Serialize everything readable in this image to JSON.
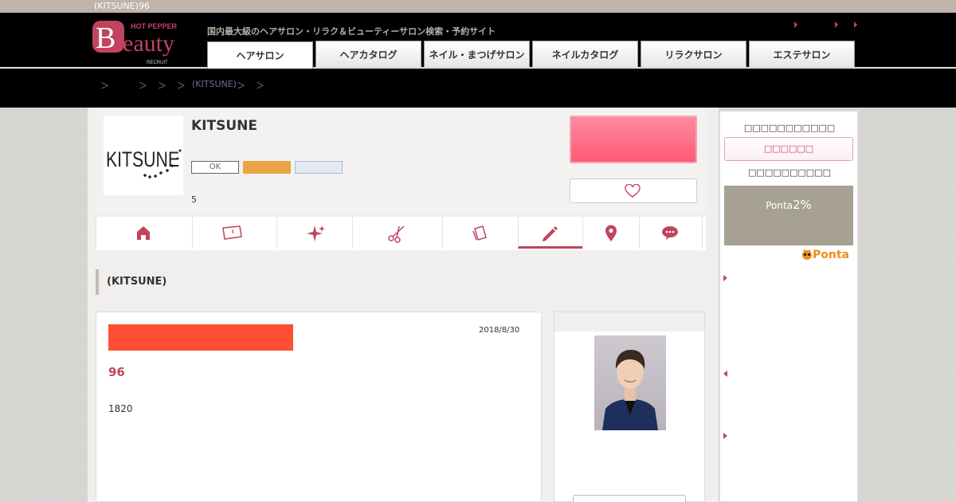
{
  "page": {
    "top_title": "(KITSUNE)96"
  },
  "header": {
    "logo": {
      "hot_pepper": "HOT PEPPER",
      "beauty": "Beauty",
      "recruit": "RECRUIT"
    },
    "tagline": "国内最大級のヘアサロン・リラク＆ビューティーサロン検索・予約サイト",
    "tabs": [
      {
        "label": "ヘアサロン",
        "active": true
      },
      {
        "label": "ヘアカタログ"
      },
      {
        "label": "ネイル・まつげサロン"
      },
      {
        "label": "ネイルカタログ"
      },
      {
        "label": "リラクサロン"
      },
      {
        "label": "エステサロン"
      }
    ]
  },
  "breadcrumb": {
    "separator": "＞",
    "salon_link": "(KITSUNE)"
  },
  "salon": {
    "name": "KITSUNE",
    "logo_text": "KITSUNE",
    "badge_ok": "OK",
    "count": "5"
  },
  "section": {
    "title": "(KITSUNE)"
  },
  "post": {
    "date": "2018/8/30",
    "title": "96",
    "body": "1820"
  },
  "sidebar": {
    "ponta_text": "Ponta",
    "ponta_rate": "2%",
    "ponta_logo": "Ponta"
  },
  "colors": {
    "accent": "#c0445f",
    "reserve": "#ff5a78",
    "post_tag": "#ff4e32",
    "badge_orange": "#e9a545",
    "ponta_box": "#a7a193"
  }
}
